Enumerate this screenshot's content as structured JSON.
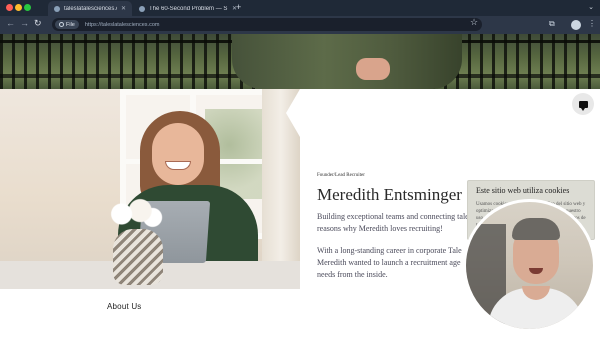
{
  "browser": {
    "tabs": [
      {
        "title": "taleslatalesciences.com",
        "active": true
      },
      {
        "title": "The 60-Second Problem — S",
        "active": false
      }
    ],
    "new_tab_glyph": "+",
    "address": {
      "scheme_chip": "File",
      "url": "https://taleslatalesciences.com"
    }
  },
  "profile": {
    "role": "Founder/Lead Recruiter",
    "name": "Meredith Entsminger",
    "para1_line1": "Building exceptional teams and connecting tale",
    "para1_line2": "reasons why Meredith loves recruiting!",
    "para2_line1": "With a long-standing career in corporate Tale",
    "para2_line2": "Meredith wanted to launch a recruitment age",
    "para2_line3": "needs from the inside."
  },
  "about_heading": "About Us",
  "cookie_banner": {
    "title": "Este sitio web utiliza cookies",
    "body": "Usamos cookies para analizar el tráfico del sitio web y optimizar tu experiencia del sitio. Al aceptar nuestro uso de cookies, tus datos se agruparán con los datos de todos los demás usuarios."
  },
  "icons": {
    "close": "close-icon",
    "chat": "chat-icon",
    "star": "star-icon",
    "extensions": "puzzle-icon",
    "menu": "kebab-icon"
  },
  "colors": {
    "chrome_dark": "#1f2937",
    "toolbar": "#2d3748",
    "page_bg": "#ffffff",
    "name_text": "#2a2a2a",
    "cookie_bg": "#dcdcd4"
  }
}
